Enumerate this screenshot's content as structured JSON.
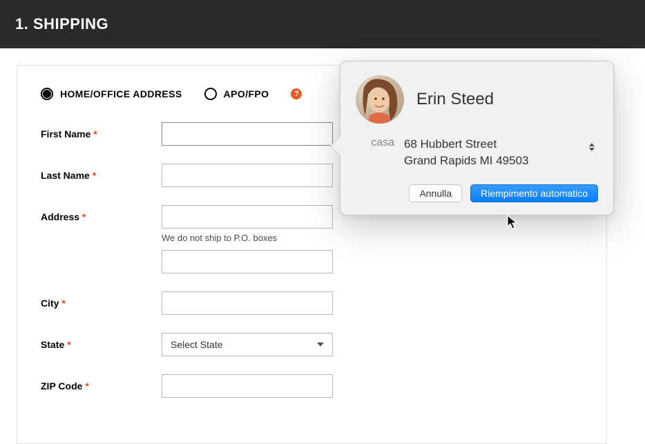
{
  "header": {
    "title": "1. SHIPPING"
  },
  "radios": {
    "home": "HOME/OFFICE ADDRESS",
    "apo": "APO/FPO",
    "help_glyph": "?"
  },
  "fields": {
    "first_name": {
      "label": "First Name",
      "required": "*",
      "value": ""
    },
    "last_name": {
      "label": "Last Name",
      "required": "*",
      "value": ""
    },
    "address": {
      "label": "Address",
      "required": "*",
      "value": "",
      "hint": "We do not ship to P.O. boxes"
    },
    "address2": {
      "value": ""
    },
    "city": {
      "label": "City",
      "required": "*",
      "value": ""
    },
    "state": {
      "label": "State",
      "required": "*",
      "selected": "Select State"
    },
    "zip": {
      "label": "ZIP Code",
      "required": "*",
      "value": ""
    }
  },
  "popover": {
    "contact_name": "Erin Steed",
    "address_label": "casa",
    "address_line1": "68 Hubbert Street",
    "address_line2": "Grand Rapids MI 49503",
    "cancel_label": "Annulla",
    "autofill_label": "Riempimento automatico"
  }
}
